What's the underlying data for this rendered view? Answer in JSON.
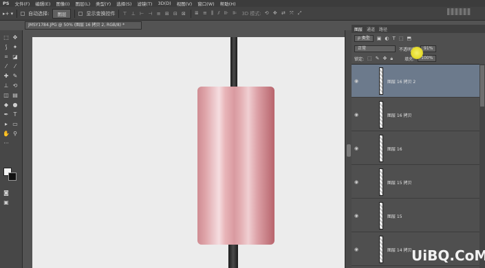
{
  "app": {
    "logo": "PS"
  },
  "menu": [
    "文件(F)",
    "编辑(E)",
    "图像(I)",
    "图层(L)",
    "类型(Y)",
    "选择(S)",
    "滤镜(T)",
    "3D(D)",
    "视图(V)",
    "窗口(W)",
    "帮助(H)"
  ],
  "options": {
    "move_tool": "▸+ ▾",
    "auto_select_label": "自动选择:",
    "auto_select_value": "图层",
    "show_transform_label": "显示变换控件",
    "mode_3d": "3D 模式:"
  },
  "document": {
    "tab_label": "JMSY1784.JPG @ 50% (图层 16 拷贝 2, RGB/8) *"
  },
  "layers_panel": {
    "tabs": [
      "图层",
      "通道",
      "路径"
    ],
    "filter_kind": "ρ 类型",
    "blend_mode": "正常",
    "opacity_label": "不透明度:",
    "opacity_value": "91%",
    "lock_label": "锁定:",
    "fill_label": "填充:",
    "fill_value": "100%",
    "layers": [
      {
        "name": "图层 16 拷贝 2",
        "selected": true
      },
      {
        "name": "图层 16 拷贝",
        "selected": false
      },
      {
        "name": "图层 16",
        "selected": false
      },
      {
        "name": "图层 15 拷贝",
        "selected": false
      },
      {
        "name": "图层 15",
        "selected": false
      },
      {
        "name": "图层 14 拷贝",
        "selected": false
      }
    ]
  },
  "watermark": "UiBQ.CoM",
  "colors": {
    "canvas_bg": "#ececec",
    "selected_layer": "#6c7a8c",
    "can_pink": "#dea3a8",
    "pole": "#2a2a2a"
  }
}
